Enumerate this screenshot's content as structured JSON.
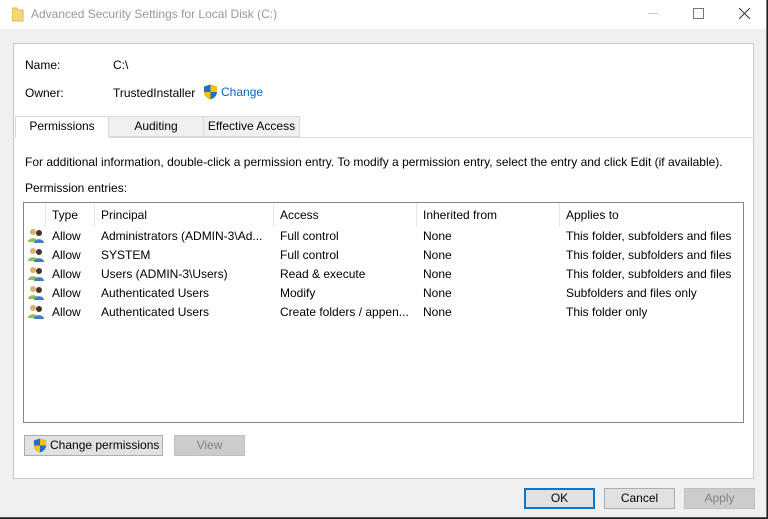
{
  "window": {
    "title": "Advanced Security Settings for Local Disk (C:)",
    "icons": {
      "app": "folder-icon",
      "minimize": "minimize-icon",
      "maximize": "maximize-icon",
      "close": "close-icon"
    }
  },
  "object": {
    "name_label": "Name:",
    "name_value": "C:\\",
    "owner_label": "Owner:",
    "owner_value": "TrustedInstaller",
    "change_owner_link": "Change",
    "change_owner_icon": "uac-shield-icon"
  },
  "tabs": [
    {
      "label": "Permissions",
      "active": true
    },
    {
      "label": "Auditing",
      "active": false
    },
    {
      "label": "Effective Access",
      "active": false
    }
  ],
  "permissions": {
    "info_text": "For additional information, double-click a permission entry. To modify a permission entry, select the entry and click Edit (if available).",
    "entries_label": "Permission entries:",
    "columns": [
      "Type",
      "Principal",
      "Access",
      "Inherited from",
      "Applies to"
    ],
    "rows": [
      {
        "icon": "users-icon",
        "type": "Allow",
        "principal": "Administrators (ADMIN-3\\Ad...",
        "access": "Full control",
        "inherited_from": "None",
        "applies_to": "This folder, subfolders and files"
      },
      {
        "icon": "users-icon",
        "type": "Allow",
        "principal": "SYSTEM",
        "access": "Full control",
        "inherited_from": "None",
        "applies_to": "This folder, subfolders and files"
      },
      {
        "icon": "users-icon",
        "type": "Allow",
        "principal": "Users (ADMIN-3\\Users)",
        "access": "Read & execute",
        "inherited_from": "None",
        "applies_to": "This folder, subfolders and files"
      },
      {
        "icon": "users-icon",
        "type": "Allow",
        "principal": "Authenticated Users",
        "access": "Modify",
        "inherited_from": "None",
        "applies_to": "Subfolders and files only"
      },
      {
        "icon": "users-icon",
        "type": "Allow",
        "principal": "Authenticated Users",
        "access": "Create folders / appen...",
        "inherited_from": "None",
        "applies_to": "This folder only"
      }
    ],
    "change_permissions_button": "Change permissions",
    "view_button": "View"
  },
  "footer": {
    "ok": "OK",
    "cancel": "Cancel",
    "apply": "Apply"
  },
  "colors": {
    "link": "#0066cc",
    "default_button_border": "#0078d7",
    "shield_blue": "#1e6fc8",
    "shield_yellow": "#f4c300"
  }
}
